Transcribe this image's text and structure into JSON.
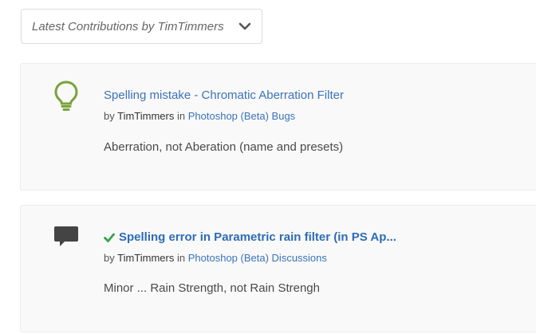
{
  "filter": {
    "label": "Latest Contributions by TimTimmers",
    "icon": "chevron-down-icon"
  },
  "contributions": [
    {
      "icon": "lightbulb-icon",
      "icon_color": "#7aa33c",
      "title": "Spelling mistake - Chromatic Aberration Filter",
      "by_prefix": "by",
      "author": "TimTimmers",
      "in_word": "in",
      "board": "Photoshop (Beta) Bugs",
      "snippet": "Aberration, not Aberation (name and presets)"
    },
    {
      "icon": "speech-bubble-icon",
      "icon_color": "#444444",
      "solved_icon": "checkmark-icon",
      "solved_color": "#3aa34a",
      "title": "Spelling error in Parametric rain filter (in PS Ap...",
      "by_prefix": "by",
      "author": "TimTimmers",
      "in_word": "in",
      "board": "Photoshop (Beta) Discussions",
      "snippet": "Minor ... Rain Strength, not Rain Strengh"
    }
  ],
  "colors": {
    "link": "#3b73b9",
    "card_background": "#f9f9f9"
  }
}
